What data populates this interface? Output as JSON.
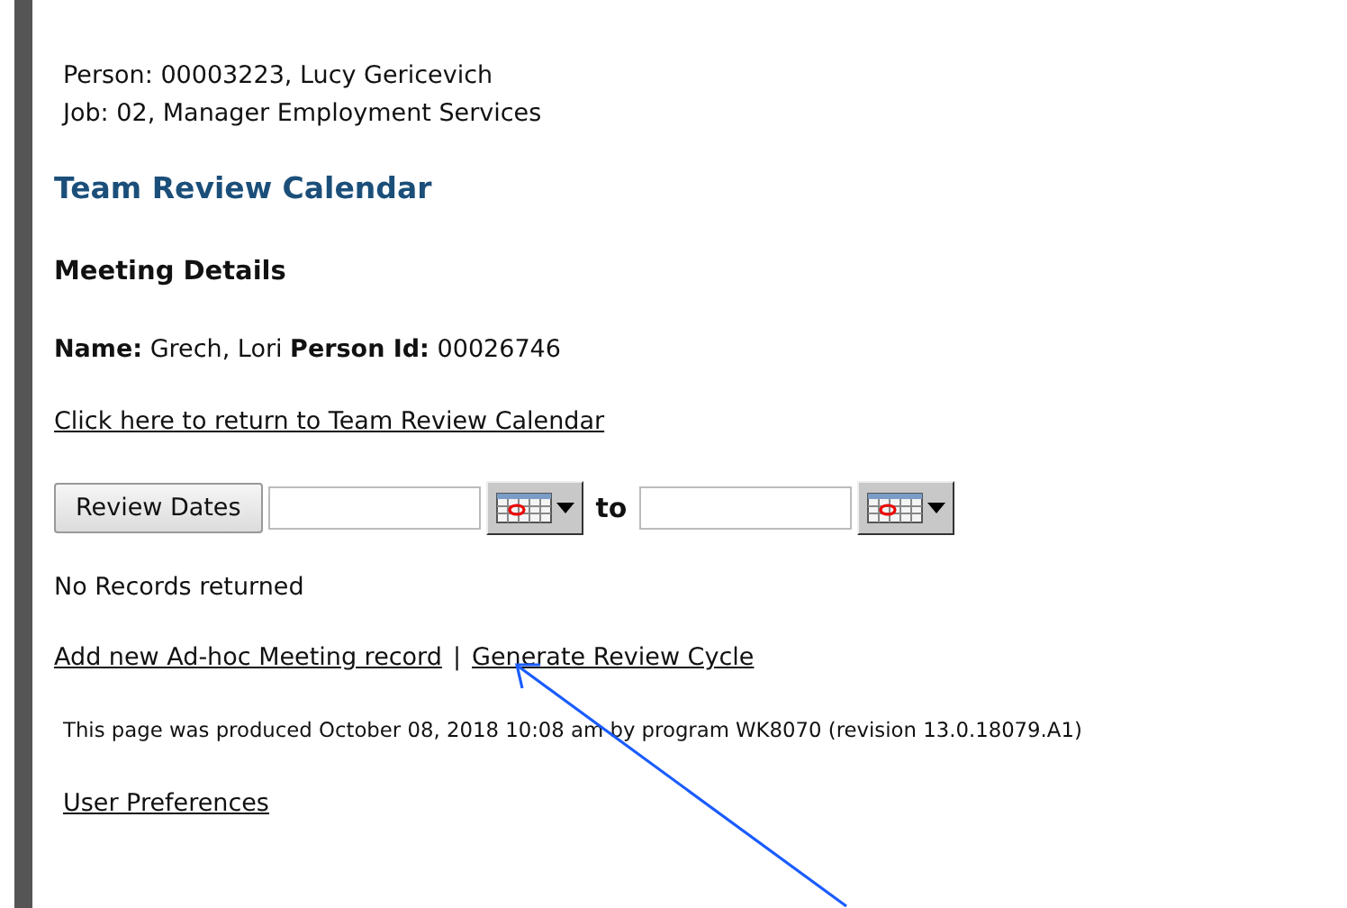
{
  "header": {
    "person": "Person: 00003223, Lucy Gericevich",
    "job": "Job: 02, Manager Employment Services"
  },
  "title": "Team Review Calendar",
  "section_heading": "Meeting Details",
  "details": "**Name:** Grech, Lori **Person Id:** 00026746",
  "return_link": "Click here to return to Team Review Calendar",
  "date_filter": {
    "button": "Review Dates",
    "separator": "to"
  },
  "message": "No Records returned",
  "actions": [
    {
      "label": "Add new Ad-hoc Meeting record"
    },
    {
      "label": "Generate Review Cycle"
    }
  ],
  "action_separator": "|",
  "footer": "This page was produced October 08, 2018 10:08 am by program WK8070 (revision 13.0.18079.A1)",
  "preferences_link": "User Preferences",
  "annotation": {
    "kind": "arrow"
  }
}
